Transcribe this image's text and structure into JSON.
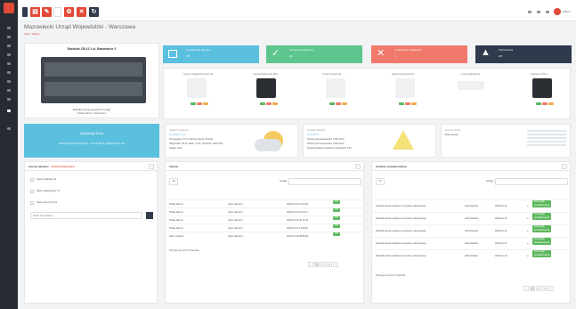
{
  "page": {
    "title": "Mazowiecki Urząd Wojewódzki - Warszawa",
    "breadcrumb": "Start / Stacja"
  },
  "device": {
    "title": "Eastside CB-10 1 ul. Basetrance 2",
    "caption1": "Eastside pracuje poprawnie (3 szafy)",
    "caption2": "Ostatni odczyt: 1 dzień temu"
  },
  "stats": [
    {
      "label": "Przełączniki aktywne",
      "value": "7/8",
      "color": "#5bc0de"
    },
    {
      "label": "Urządzenia aktywne",
      "value": "15",
      "color": "#5cc68e"
    },
    {
      "label": "Urządzenia nieaktywne",
      "value": "1",
      "color": "#f0796c"
    },
    {
      "label": "Ostrzeżenia",
      "value": "2/3",
      "color": "#2f3b4c"
    }
  ],
  "tiles": [
    "System Nagłośnieniowy 01",
    "Syrena Alarmowa SS4",
    "Czujnik Drgań 01",
    "Stacja Pogodowa 01",
    "Linia zasilania 01",
    "Zasilacz UPS 1"
  ],
  "alert_box": {
    "title": "Dystrybucja Treści",
    "subtitle": "Sieć Dynamiczna Syreny - ok 10,58 % pojedyncze 1.42"
  },
  "weather": {
    "heading": "Stacja Pogodowa",
    "line1": "ok 10,58 % 1.42",
    "line2": "Temperatura: 8 °C, Zachmurzenie: Średnie",
    "line3": "Wilgotność: 45 %, Wiatr: 4 m/s, Ciśnienie: 1016 hPa",
    "line4": "Opady: brak"
  },
  "radiation": {
    "heading": "Czujnik Radiacji",
    "line1": "ok 10,58 %",
    "line2": "Poziom promieniowania: 0,09 µSv/h",
    "line3": "Poziom promieniowania: 0,08 µSv/h",
    "line4": "Średnia dawka w ostatnich godzinach: 0,07"
  },
  "water": {
    "heading": "Poziom Wody",
    "line1": "Brak odczytu"
  },
  "left_panel": {
    "title": "Alarmy aktywne",
    "subtitle": "Poziom Ostrzeżeń",
    "items": [
      "Alarm pożarowy 01",
      "Alarm ewakuacyjny 01",
      "Alarm chemiczny 01"
    ],
    "search_placeholder": "Wpisz treść alarmu"
  },
  "mid_panel": {
    "title": "Alarmy",
    "search_label": "Szukaj:",
    "page_size": "10",
    "rows": [
      {
        "name": "Próba Alarmu",
        "type": "Alarm aktywny",
        "date": "2022-04-14 10:25:03",
        "status": "OK"
      },
      {
        "name": "Próba Alarmu",
        "type": "Alarm aktywny",
        "date": "2022-04-13 11:40:17",
        "status": "OK"
      },
      {
        "name": "Próba Alarmu",
        "type": "Alarm aktywny",
        "date": "2022-04-12 09:12:44",
        "status": "OK"
      },
      {
        "name": "Próba Alarmu",
        "type": "Alarm aktywny",
        "date": "2022-04-11 14:05:30",
        "status": "OK"
      },
      {
        "name": "Alarm testowy",
        "type": "Alarm aktywny",
        "date": "2022-04-10 08:55:02",
        "status": "OK"
      }
    ],
    "footer": "Pozycje od 1 do 5 z 5 łącznie",
    "pages": [
      "‹",
      "1",
      "2",
      "3",
      "›"
    ]
  },
  "right_panel": {
    "title": "Ostatnie powiadomienia",
    "search_label": "Szukaj:",
    "page_size": "10",
    "rows": [
      {
        "text": "Powiadomienie wysłane do systemu alarmowego",
        "who": "Administrator",
        "date": "2022-04-14",
        "action": "Szczegóły powiadomienia"
      },
      {
        "text": "Powiadomienie wysłane do systemu alarmowego",
        "who": "Administrator",
        "date": "2022-04-13",
        "action": "Szczegóły powiadomienia"
      },
      {
        "text": "Powiadomienie wysłane do systemu alarmowego",
        "who": "Administrator",
        "date": "2022-04-12",
        "action": "Szczegóły powiadomienia"
      },
      {
        "text": "Powiadomienie wysłane do systemu alarmowego",
        "who": "Administrator",
        "date": "2022-04-11",
        "action": "Szczegóły powiadomienia"
      },
      {
        "text": "Powiadomienie wysłane do systemu alarmowego",
        "who": "Administrator",
        "date": "2022-04-10",
        "action": "Szczegóły powiadomienia"
      }
    ],
    "footer": "Pozycje od 1 do 5 z 5 łącznie",
    "pages": [
      "‹",
      "1",
      "2",
      "3",
      "›"
    ]
  },
  "user": {
    "name": "Admin"
  }
}
